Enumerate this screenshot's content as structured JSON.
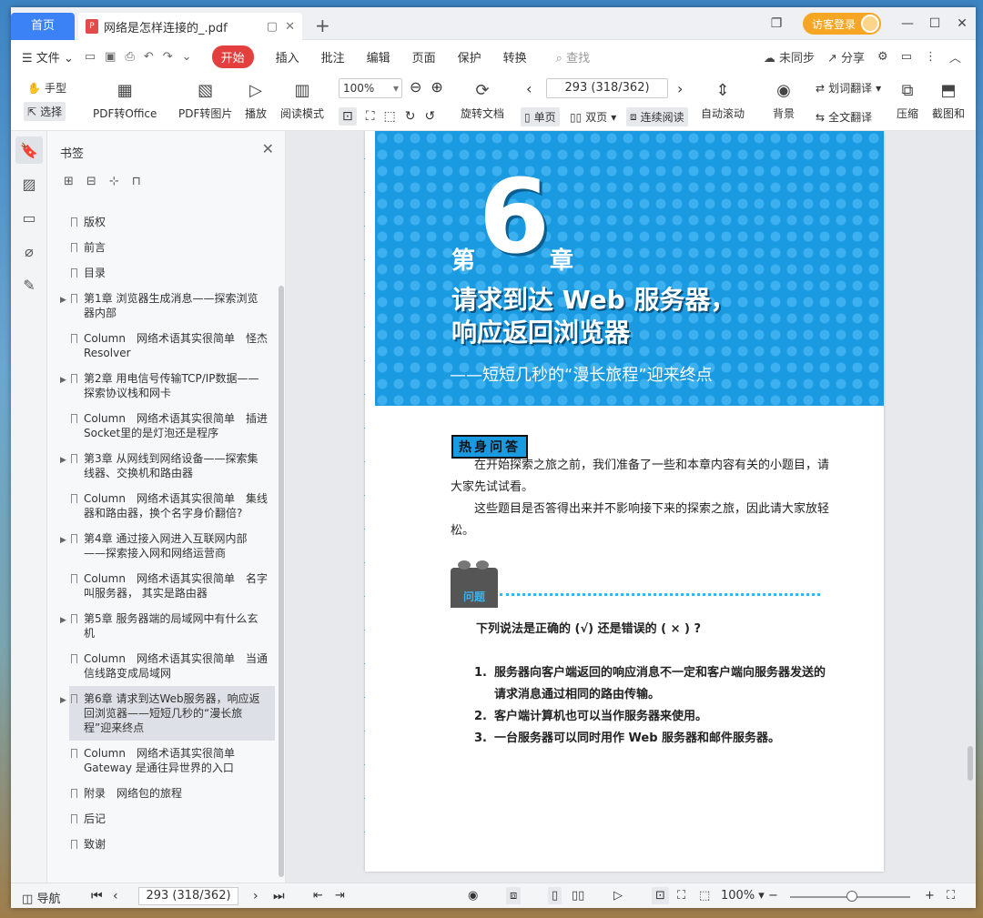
{
  "tabs": {
    "home": "首页",
    "doc": "网络是怎样连接的_.pdf",
    "new": "+"
  },
  "titlebar": {
    "visitor": "访客登录"
  },
  "menu": {
    "file": "文件",
    "items": [
      "开始",
      "插入",
      "批注",
      "编辑",
      "页面",
      "保护",
      "转换"
    ],
    "search": "查找",
    "unsync": "未同步",
    "share": "分享"
  },
  "toolbar": {
    "hand": "手型",
    "select": "选择",
    "pdf_office": "PDF转Office",
    "pdf_img": "PDF转图片",
    "play": "播放",
    "read_mode": "阅读模式",
    "zoom": "100%",
    "rotate": "旋转文档",
    "page": "293 (318/362)",
    "single": "单页",
    "double": "双页",
    "continuous": "连续阅读",
    "autoscroll": "自动滚动",
    "bg": "背景",
    "word_trans": "划词翻译",
    "full_trans": "全文翻译",
    "compress": "压缩",
    "screenshot": "截图和"
  },
  "bookmarks": {
    "title": "书签",
    "items": [
      {
        "label": "版权"
      },
      {
        "label": "前言"
      },
      {
        "label": "目录"
      },
      {
        "label": "第1章 浏览器生成消息——探索浏览器内部",
        "expand": "▶"
      },
      {
        "label": "Column　网络术语其实很简单　怪杰Resolver"
      },
      {
        "label": "第2章 用电信号传输TCP/IP数据——探索协议栈和网卡",
        "expand": "▶"
      },
      {
        "label": "Column　网络术语其实很简单　插进Socket里的是灯泡还是程序"
      },
      {
        "label": "第3章 从网线到网络设备——探索集线器、交换机和路由器",
        "expand": "▶"
      },
      {
        "label": "Column　网络术语其实很简单　集线器和路由器，换个名字身价翻倍?"
      },
      {
        "label": "第4章 通过接入网进入互联网内部——探索接入网和网络运营商",
        "expand": "▶"
      },
      {
        "label": "Column　网络术语其实很简单　名字叫服务器， 其实是路由器"
      },
      {
        "label": "第5章 服务器端的局域网中有什么玄机",
        "expand": "▶"
      },
      {
        "label": "Column　网络术语其实很简单　当通信线路变成局域网"
      },
      {
        "label": "第6章 请求到达Web服务器，响应返回浏览器——短短几秒的“漫长旅程”迎来终点",
        "expand": "▶",
        "active": true
      },
      {
        "label": "Column　网络术语其实很简单　Gateway 是通往异世界的入口"
      },
      {
        "label": "附录　网络包的旅程"
      },
      {
        "label": "后记"
      },
      {
        "label": "致谢"
      }
    ]
  },
  "doc": {
    "chapter_di": "第",
    "chapter_num": "6",
    "chapter_zhang": "章",
    "title_line1": "请求到达 Web 服务器，",
    "title_line2": "响应返回浏览器",
    "subtitle": "——短短几秒的“漫长旅程”迎来终点",
    "warmup": "热身问答",
    "para1": "在开始探索之旅之前，我们准备了一些和本章内容有关的小题目，请大家先试试看。",
    "para2": "这些题目是否答得出来并不影响接下来的探索之旅，因此请大家放轻松。",
    "question_label": "问题",
    "question": "下列说法是正确的 (√) 还是错误的 ( × ) ?",
    "q_items": [
      {
        "n": "1.",
        "t": "服务器向客户端返回的响应消息不一定和客户端向服务器发送的请求消息通过相同的路由传输。"
      },
      {
        "n": "2.",
        "t": "客户端计算机也可以当作服务器来使用。"
      },
      {
        "n": "3.",
        "t": "一台服务器可以同时用作 Web 服务器和邮件服务器。"
      }
    ]
  },
  "status": {
    "nav": "导航",
    "page": "293 (318/362)",
    "zoom": "100%",
    "zoom_level": 0.5
  }
}
